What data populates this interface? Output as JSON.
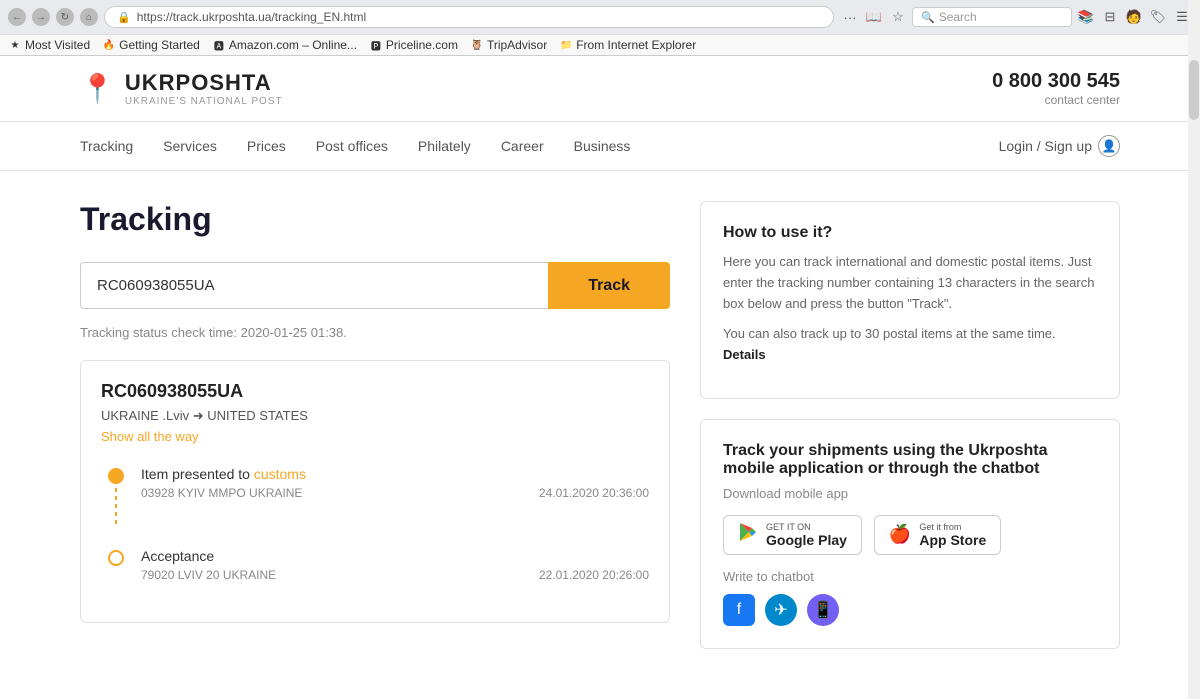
{
  "browser": {
    "url": "https://track.ukrposhta.ua/tracking_EN.html",
    "search_placeholder": "Search",
    "bookmarks": [
      {
        "label": "Most Visited",
        "icon": "★"
      },
      {
        "label": "Getting Started",
        "icon": "🔥"
      },
      {
        "label": "Amazon.com – Online...",
        "icon": "a"
      },
      {
        "label": "Priceline.com",
        "icon": "p"
      },
      {
        "label": "TripAdvisor",
        "icon": "🦉"
      },
      {
        "label": "From Internet Explorer",
        "icon": "📁"
      }
    ]
  },
  "header": {
    "logo_name": "UKRPOSHTA",
    "logo_tagline": "UKRAINE'S NATIONAL POST",
    "phone": "0 800 300 545",
    "contact_label": "contact center"
  },
  "nav": {
    "links": [
      {
        "label": "Tracking"
      },
      {
        "label": "Services"
      },
      {
        "label": "Prices"
      },
      {
        "label": "Post offices"
      },
      {
        "label": "Philately"
      },
      {
        "label": "Career"
      },
      {
        "label": "Business"
      }
    ],
    "auth_label": "Login / Sign up"
  },
  "tracking": {
    "page_title": "Tracking",
    "input_value": "RC060938055UA",
    "track_button": "Track",
    "status_time": "Tracking status check time: 2020-01-25 01:38.",
    "result": {
      "number": "RC060938055UA",
      "from": "UKRAINE .Lviv",
      "to": "UNITED STATES",
      "show_way": "Show all the way"
    },
    "events": [
      {
        "title": "Item presented to customs",
        "location": "03928 KYIV MMPO UKRAINE",
        "date": "24.01.2020 20:36:00",
        "dot_filled": true
      },
      {
        "title": "Acceptance",
        "location": "79020 LVIV 20 UKRAINE",
        "date": "22.01.2020 20:26:00",
        "dot_filled": false
      }
    ]
  },
  "how_to": {
    "title": "How to use it?",
    "text1": "Here you can track international and domestic postal items. Just enter the tracking number containing 13 characters in the search box below and press the button \"Track\".",
    "text2": "You can also track up to 30 postal items at the same time.",
    "details_link": "Details"
  },
  "app_promo": {
    "title": "Track your shipments using the Ukrposhta mobile application or through the chatbot",
    "subtitle": "Download mobile app",
    "google_play_label": "GET IT ON",
    "google_play_name": "Google Play",
    "app_store_label": "Get it from",
    "app_store_name": "App Store",
    "chatbot_label": "Write to chatbot",
    "social": [
      {
        "name": "Facebook",
        "icon": "f"
      },
      {
        "name": "Telegram",
        "icon": "✈"
      },
      {
        "name": "Viber",
        "icon": "📞"
      }
    ]
  }
}
